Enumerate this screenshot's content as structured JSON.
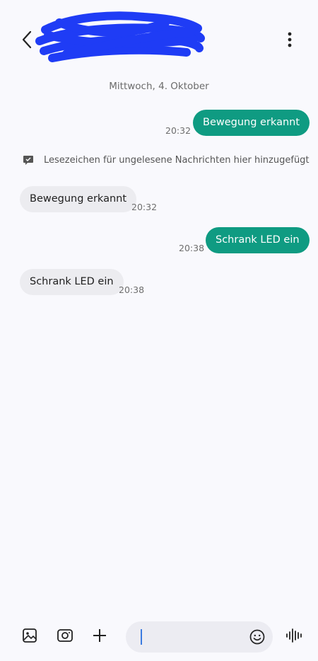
{
  "header": {
    "back_icon": "chevron-left-icon",
    "more_icon": "more-vertical-icon",
    "redaction_color": "#1f3cf5"
  },
  "conversation": {
    "date_separator": "Mittwoch, 4. Oktober",
    "bookmark_notice": "Lesezeichen für ungelesene Nachrichten hier hinzugefügt",
    "messages": [
      {
        "direction": "outgoing",
        "text": "Bewegung erkannt",
        "time": "20:32"
      },
      {
        "direction": "incoming",
        "text": "Bewegung erkannt",
        "time": "20:32"
      },
      {
        "direction": "outgoing",
        "text": "Schrank LED ein",
        "time": "20:38"
      },
      {
        "direction": "incoming",
        "text": "Schrank LED ein",
        "time": "20:38"
      }
    ]
  },
  "composer": {
    "value": "",
    "placeholder": "",
    "icons": [
      "gallery-icon",
      "camera-icon",
      "plus-icon",
      "emoji-icon",
      "voice-icon"
    ]
  },
  "colors": {
    "outgoing_bubble": "#0f9b82",
    "incoming_bubble": "#ececf0",
    "background": "#f9f9fd"
  }
}
